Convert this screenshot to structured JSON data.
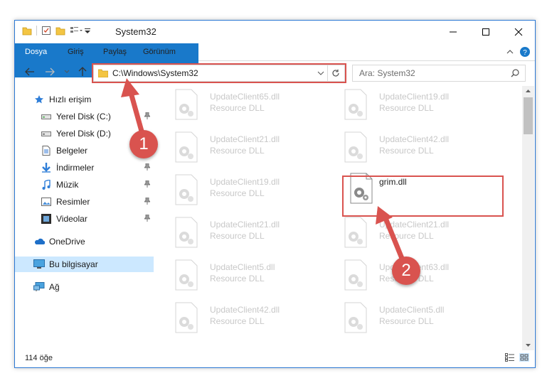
{
  "window": {
    "title": "System32"
  },
  "ribbon": {
    "tabs": [
      {
        "label": "Dosya"
      },
      {
        "label": "Giriş"
      },
      {
        "label": "Paylaş"
      },
      {
        "label": "Görünüm"
      }
    ]
  },
  "address": {
    "path": "C:\\Windows\\System32"
  },
  "search": {
    "placeholder": "Ara: System32"
  },
  "nav": {
    "items": [
      {
        "label": "Hızlı erişim",
        "icon": "star-icon"
      },
      {
        "label": "Yerel Disk (C:)",
        "icon": "drive-icon",
        "pinned": true
      },
      {
        "label": "Yerel Disk (D:)",
        "icon": "drive-icon"
      },
      {
        "label": "Belgeler",
        "icon": "documents-icon"
      },
      {
        "label": "İndirmeler",
        "icon": "download-icon",
        "pinned": true
      },
      {
        "label": "Müzik",
        "icon": "music-icon",
        "pinned": true
      },
      {
        "label": "Resimler",
        "icon": "pictures-icon",
        "pinned": true
      },
      {
        "label": "Videolar",
        "icon": "videos-icon",
        "pinned": true
      },
      {
        "label": "OneDrive",
        "icon": "cloud-icon"
      },
      {
        "label": "Bu bilgisayar",
        "icon": "computer-icon"
      },
      {
        "label": "Ağ",
        "icon": "network-icon"
      }
    ]
  },
  "files": [
    {
      "name": "UpdateClient65.dll",
      "type": "Resource DLL"
    },
    {
      "name": "UpdateClient19.dll",
      "type": "Resource DLL"
    },
    {
      "name": "UpdateClient21.dll",
      "type": "Resource DLL"
    },
    {
      "name": "UpdateClient42.dll",
      "type": "Resource DLL"
    },
    {
      "name": "UpdateClient19.dll",
      "type": "Resource DLL"
    },
    {
      "name": "grim.dll",
      "type": ""
    },
    {
      "name": "UpdateClient21.dll",
      "type": "Resource DLL"
    },
    {
      "name": "UpdateClient21.dll",
      "type": "Resource DLL"
    },
    {
      "name": "UpdateClient5.dll",
      "type": "Resource DLL"
    },
    {
      "name": "UpdateClient63.dll",
      "type": "Resource DLL"
    },
    {
      "name": "UpdateClient42.dll",
      "type": "Resource DLL"
    },
    {
      "name": "UpdateClient5.dll",
      "type": "Resource DLL"
    }
  ],
  "status": {
    "count": "114 öğe"
  },
  "annotations": {
    "step1": "1",
    "step2": "2",
    "color": "#d9534f"
  }
}
